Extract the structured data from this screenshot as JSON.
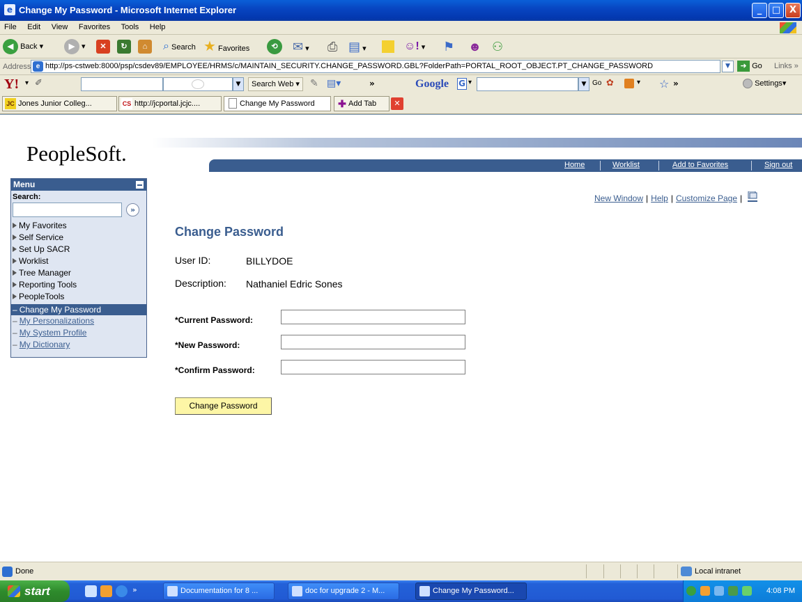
{
  "window": {
    "title": "Change My Password - Microsoft Internet Explorer",
    "controls": [
      "_",
      "□",
      "X"
    ]
  },
  "menubar": {
    "items": [
      "File",
      "Edit",
      "View",
      "Favorites",
      "Tools",
      "Help"
    ]
  },
  "toolbar": {
    "back_label": "Back",
    "search_label": "Search",
    "favorites_label": "Favorites"
  },
  "address": {
    "label": "Address",
    "url": "http://ps-cstweb:8000/psp/csdev89/EMPLOYEE/HRMS/c/MAINTAIN_SECURITY.CHANGE_PASSWORD.GBL?FolderPath=PORTAL_ROOT_OBJECT.PT_CHANGE_PASSWORD",
    "go_label": "Go",
    "links_label": "Links"
  },
  "yahoo_bar": {
    "search_web_label": "Search Web",
    "google_label": "Google",
    "go_label": "Go",
    "settings_label": "Settings"
  },
  "tabs": [
    {
      "label": "Jones Junior Colleg...",
      "icon": "JC"
    },
    {
      "label": "http://jcportal.jcjc....",
      "icon": "CS"
    },
    {
      "label": "Change My Password",
      "icon": "page"
    }
  ],
  "add_tab_label": "Add Tab",
  "peoplesoft": {
    "logo": "PeopleSoft.",
    "nav": [
      "Home",
      "Worklist",
      "Add to Favorites",
      "Sign out"
    ]
  },
  "menu": {
    "title": "Menu",
    "search_label": "Search:",
    "search_value": "",
    "go_icon": "»",
    "folders": [
      "My Favorites",
      "Self Service",
      "Set Up SACR",
      "Worklist",
      "Tree Manager",
      "Reporting Tools",
      "PeopleTools"
    ],
    "current": "Change My Password",
    "links": [
      "My Personalizations",
      "My System Profile",
      "My Dictionary"
    ]
  },
  "pagelinks": [
    "New Window",
    "Help",
    "Customize Page"
  ],
  "page": {
    "title": "Change Password",
    "user_id_label": "User ID:",
    "user_id_value": "BILLYDOE",
    "description_label": "Description:",
    "description_value": "Nathaniel Edric Sones",
    "current_password_label": "*Current Password:",
    "new_password_label": "*New Password:",
    "confirm_password_label": "*Confirm Password:",
    "current_password_value": "",
    "new_password_value": "",
    "confirm_password_value": "",
    "button_label": "Change Password"
  },
  "status": {
    "text": "Done",
    "zone": "Local intranet"
  },
  "taskbar": {
    "start_label": "start",
    "tasks": [
      "Documentation for 8 ...",
      "doc for upgrade 2 - M...",
      "Change My Password..."
    ],
    "clock": "4:08 PM"
  },
  "colors": {
    "ps_blue": "#3a5d8f",
    "button_yellow": "#fdf6a6",
    "xp_blue": "#0846c2"
  }
}
